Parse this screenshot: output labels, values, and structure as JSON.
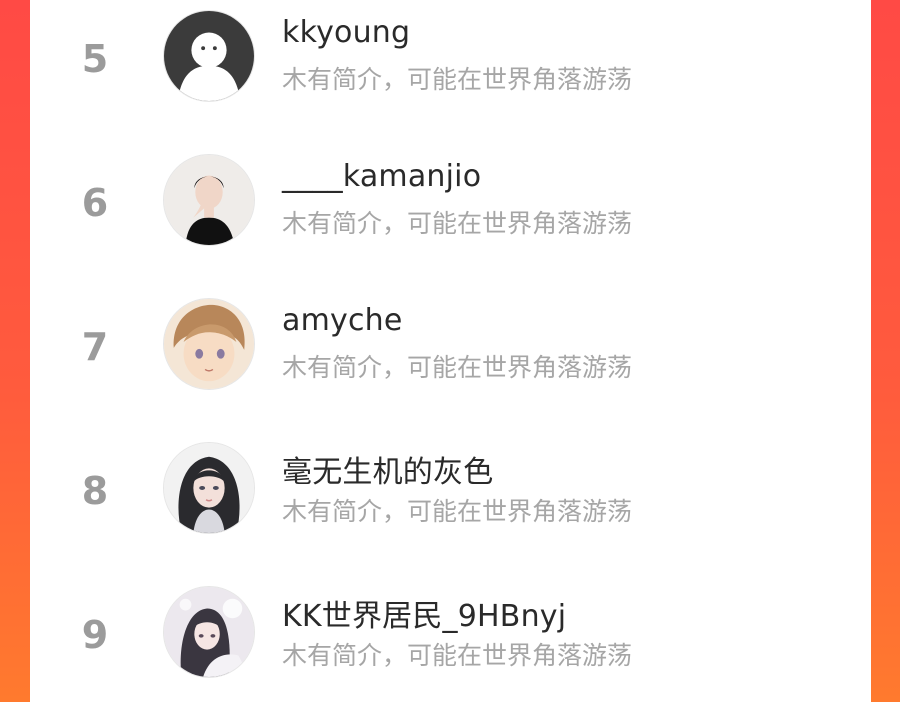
{
  "ranking": {
    "items": [
      {
        "rank": "5",
        "name": "kkyoung",
        "bio": "木有简介，可能在世界角落游荡",
        "avatar_icon": "default-user-avatar-icon"
      },
      {
        "rank": "6",
        "name": "____kamanjio",
        "bio": "木有简介，可能在世界角落游荡",
        "avatar_icon": "woman-portrait-avatar-icon"
      },
      {
        "rank": "7",
        "name": "amyche",
        "bio": "木有简介，可能在世界角落游荡",
        "avatar_icon": "anime-boy-avatar-icon"
      },
      {
        "rank": "8",
        "name": "毫无生机的灰色",
        "bio": "木有简介，可能在世界角落游荡",
        "avatar_icon": "anime-girl-avatar-icon"
      },
      {
        "rank": "9",
        "name": "KK世界居民_9HBnyj",
        "bio": "木有简介，可能在世界角落游荡",
        "avatar_icon": "illustrated-girl-avatar-icon"
      }
    ]
  },
  "colors": {
    "background_gradient_top": "#ff4a45",
    "background_gradient_bottom": "#ff7a2e",
    "card": "#ffffff",
    "rank_text": "#9b9b9b",
    "name_text": "#2a2a2a",
    "bio_text": "#a6a6a6"
  }
}
